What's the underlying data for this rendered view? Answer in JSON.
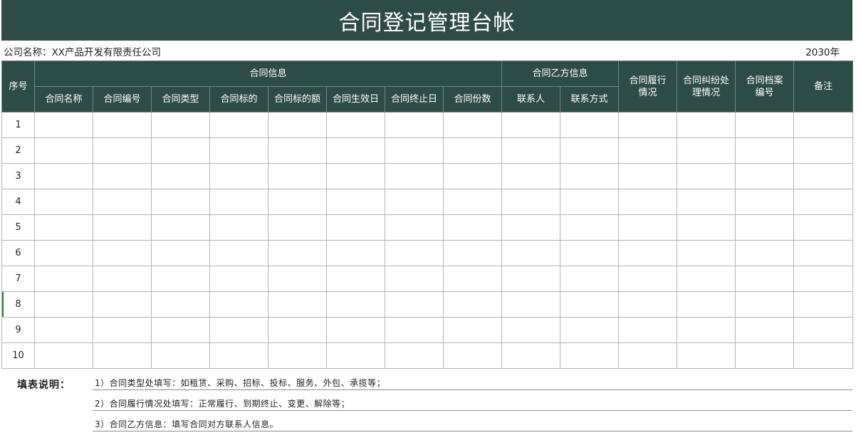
{
  "title": "合同登记管理台帐",
  "company": {
    "label": "公司名称：XX产品开发有限责任公司",
    "year": "2030年"
  },
  "table": {
    "group_headers": {
      "index": "序号",
      "contract_info": "合同信息",
      "party_b_info": "合同乙方信息",
      "performance": "合同履行情况",
      "dispute": "合同纠纷处理情况",
      "archive": "合同档案编号",
      "remarks": "备注"
    },
    "sub_headers": [
      "合同名称",
      "合同编号",
      "合同类型",
      "合同标的",
      "合同标的额",
      "合同生效日",
      "合同终止日",
      "合同份数",
      "联系人",
      "联系方式"
    ],
    "rows": [
      "1",
      "2",
      "3",
      "4",
      "5",
      "6",
      "7",
      "8",
      "9",
      "10"
    ]
  },
  "notes": {
    "title": "填表说明：",
    "lines": [
      "1）合同类型处填写：如租赁、采购、招标、投标、服务、外包、承揽等；",
      "2）合同履行情况处填写：正常履行、到期终止、变更、解除等；",
      "3）合同乙方信息：填写合同对方联系人信息。"
    ]
  }
}
